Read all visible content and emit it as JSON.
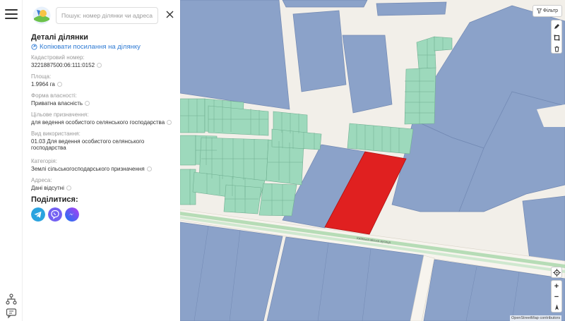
{
  "search": {
    "placeholder": "Пошук: номер ділянки чи адреса"
  },
  "panel": {
    "title": "Деталі ділянки",
    "copy_link": "Копіювати посилання на ділянку",
    "fields": [
      {
        "label": "Кадастровий номер:",
        "value": "3221887500:06:111:0152"
      },
      {
        "label": "Площа:",
        "value": "1.9964 га"
      },
      {
        "label": "Форма власності:",
        "value": "Приватна власність"
      },
      {
        "label": "Цільове призначення:",
        "value": "для ведення особистого селянського господарства"
      },
      {
        "label": "Вид використання:",
        "value": "01.03 Для ведення особистого селянського господарства"
      },
      {
        "label": "Категорія:",
        "value": "Землі сільськогосподарського призначення"
      },
      {
        "label": "Адреса:",
        "value": "Дані відсутні"
      }
    ],
    "share_title": "Поділитися:",
    "share": [
      "telegram-icon",
      "viber-icon",
      "messenger-icon"
    ]
  },
  "map": {
    "filter_label": "Фільтр",
    "attribution": "OpenStreetMap contributors",
    "road_label": "Київська міська вулиця",
    "colors": {
      "background": "#f2efe9",
      "parcel_blue": "#8ba2c9",
      "parcel_green": "#9dd9bc",
      "selected": "#e02020",
      "road_green": "#b6dcb6"
    }
  },
  "zoom": {
    "in": "+",
    "out": "−"
  }
}
